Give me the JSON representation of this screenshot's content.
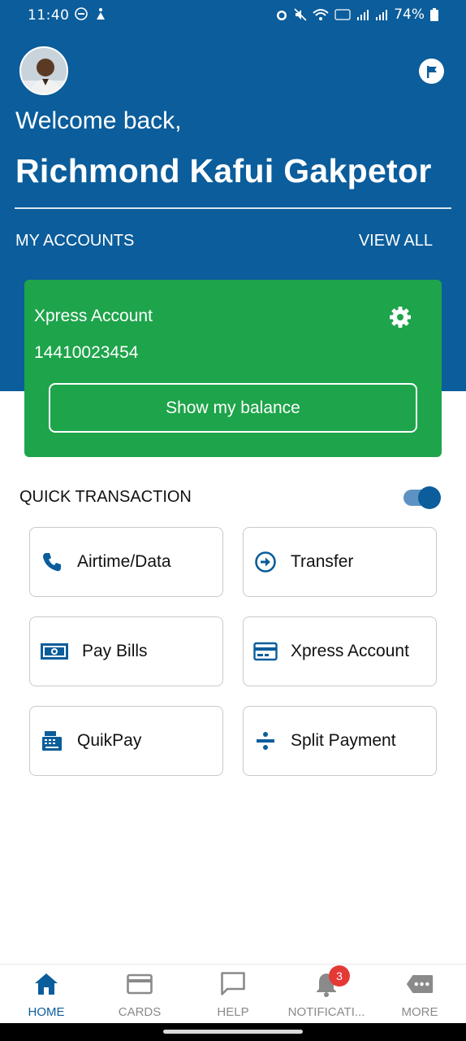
{
  "status_bar": {
    "time": "11:40",
    "battery": "74%"
  },
  "header": {
    "welcome": "Welcome back,",
    "username": "Richmond Kafui Gakpetor",
    "my_accounts": "MY ACCOUNTS",
    "view_all": "VIEW ALL"
  },
  "account": {
    "name": "Xpress Account",
    "number": "14410023454",
    "show_balance": "Show my balance"
  },
  "quick": {
    "title": "QUICK TRANSACTION",
    "toggle_on": true,
    "tiles": [
      {
        "label": "Airtime/Data",
        "icon": "phone-icon"
      },
      {
        "label": "Transfer",
        "icon": "arrow-circle-icon"
      },
      {
        "label": "Pay Bills",
        "icon": "money-icon"
      },
      {
        "label": "Xpress Account",
        "icon": "card-icon"
      },
      {
        "label": "QuikPay",
        "icon": "cash-register-icon"
      },
      {
        "label": "Split Payment",
        "icon": "divide-icon"
      }
    ]
  },
  "nav": {
    "items": [
      {
        "label": "HOME",
        "icon": "home-icon",
        "active": true
      },
      {
        "label": "CARDS",
        "icon": "card-icon"
      },
      {
        "label": "HELP",
        "icon": "chat-icon"
      },
      {
        "label": "NOTIFICATI...",
        "icon": "bell-icon",
        "badge": "3"
      },
      {
        "label": "MORE",
        "icon": "more-icon"
      }
    ]
  },
  "colors": {
    "brand_blue": "#0b5d9b",
    "card_green": "#1ea44a",
    "badge_red": "#e53935",
    "nav_inactive": "#8a8a8a"
  }
}
